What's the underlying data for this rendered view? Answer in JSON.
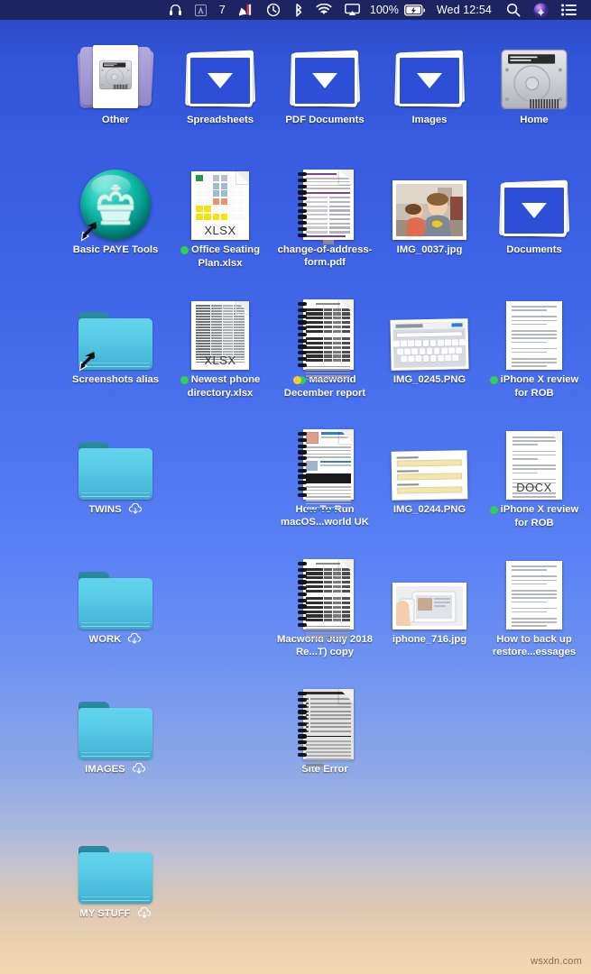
{
  "menubar": {
    "background_color": "#1e2461",
    "items": [
      {
        "name": "headphones-icon",
        "type": "icon",
        "label": "headphones"
      },
      {
        "name": "adobe-icon",
        "type": "icon",
        "label": "A"
      },
      {
        "name": "seven-indicator",
        "type": "text",
        "label": "7"
      },
      {
        "name": "textexpander-icon",
        "type": "icon",
        "label": "textexpander"
      },
      {
        "name": "time-machine-icon",
        "type": "icon",
        "label": "time-machine"
      },
      {
        "name": "bluetooth-icon",
        "type": "icon",
        "label": "bluetooth"
      },
      {
        "name": "wifi-icon",
        "type": "icon",
        "label": "wifi"
      },
      {
        "name": "airplay-icon",
        "type": "icon",
        "label": "airplay"
      }
    ],
    "battery_percent": "100%",
    "clock": "Wed 12:54",
    "search_icon": "search-icon",
    "siri_icon": "siri-icon",
    "control_center_icon": "notification-center-icon"
  },
  "desktop": {
    "watermark": "wsxdn.com",
    "columns": 5,
    "icons": [
      {
        "id": "other",
        "label": "Other",
        "type": "other-stack",
        "row": 0,
        "col": 0,
        "tags": [],
        "cloud": false,
        "alias": false
      },
      {
        "id": "spreadsheets",
        "label": "Spreadsheets",
        "type": "stack",
        "row": 0,
        "col": 1,
        "tags": [],
        "cloud": false,
        "alias": false
      },
      {
        "id": "pdf-documents",
        "label": "PDF Documents",
        "type": "stack",
        "row": 0,
        "col": 2,
        "tags": [],
        "cloud": false,
        "alias": false
      },
      {
        "id": "images-stack",
        "label": "Images",
        "type": "stack",
        "row": 0,
        "col": 3,
        "tags": [],
        "cloud": false,
        "alias": false
      },
      {
        "id": "home",
        "label": "Home",
        "type": "harddisk",
        "row": 0,
        "col": 4,
        "tags": [],
        "cloud": false,
        "alias": false
      },
      {
        "id": "basic-paye-tools",
        "label": "Basic PAYE Tools",
        "type": "app-orb",
        "row": 1,
        "col": 0,
        "tags": [],
        "cloud": false,
        "alias": true
      },
      {
        "id": "office-seating-plan",
        "label": "Office Seating Plan.xlsx",
        "type": "xlsx",
        "row": 1,
        "col": 1,
        "tags": [
          "green"
        ],
        "cloud": false,
        "alias": false
      },
      {
        "id": "change-of-address-form",
        "label": "change-of-address-form.pdf",
        "type": "spiral-form",
        "row": 1,
        "col": 2,
        "tags": [],
        "cloud": false,
        "alias": false
      },
      {
        "id": "img-0037",
        "label": "IMG_0037.jpg",
        "type": "photo-kids",
        "row": 1,
        "col": 3,
        "tags": [],
        "cloud": false,
        "alias": false
      },
      {
        "id": "documents",
        "label": "Documents",
        "type": "stack",
        "row": 1,
        "col": 4,
        "tags": [],
        "cloud": false,
        "alias": false
      },
      {
        "id": "screenshots-alias",
        "label": "Screenshots alias",
        "type": "folder",
        "row": 2,
        "col": 0,
        "tags": [],
        "cloud": false,
        "alias": true
      },
      {
        "id": "newest-phone-directory",
        "label": "Newest phone directory.xlsx",
        "type": "xlsx-list",
        "row": 2,
        "col": 1,
        "tags": [
          "green"
        ],
        "cloud": false,
        "alias": false
      },
      {
        "id": "macworld-december-report",
        "label": "Macworld December report",
        "type": "spiral-table",
        "row": 2,
        "col": 2,
        "tags": [
          "yellow",
          "green"
        ],
        "cloud": false,
        "alias": false
      },
      {
        "id": "img-0245",
        "label": "IMG_0245.PNG",
        "type": "photo-keyboard",
        "row": 2,
        "col": 3,
        "tags": [],
        "cloud": false,
        "alias": false
      },
      {
        "id": "iphone-x-review-rob-1",
        "label": "iPhone X review for ROB",
        "type": "text-doc",
        "row": 2,
        "col": 4,
        "tags": [
          "green"
        ],
        "cloud": false,
        "alias": false
      },
      {
        "id": "twins",
        "label": "TWINS",
        "type": "folder",
        "row": 3,
        "col": 0,
        "tags": [],
        "cloud": true,
        "alias": false
      },
      {
        "id": "how-to-run-macos",
        "label": "How To Run macOS...world UK",
        "type": "spiral-web",
        "row": 3,
        "col": 2,
        "tags": [],
        "cloud": false,
        "alias": false
      },
      {
        "id": "img-0244",
        "label": "IMG_0244.PNG",
        "type": "photo-form",
        "row": 3,
        "col": 3,
        "tags": [],
        "cloud": false,
        "alias": false
      },
      {
        "id": "iphone-x-review-rob-2",
        "label": "iPhone X review for ROB",
        "type": "docx",
        "row": 3,
        "col": 4,
        "tags": [
          "green"
        ],
        "cloud": false,
        "alias": false
      },
      {
        "id": "work",
        "label": "WORK",
        "type": "folder",
        "row": 4,
        "col": 0,
        "tags": [],
        "cloud": true,
        "alias": false
      },
      {
        "id": "macworld-july-2018",
        "label": "Macworld July 2018 Re...T) copy",
        "type": "spiral-table",
        "row": 4,
        "col": 2,
        "tags": [],
        "cloud": false,
        "alias": false
      },
      {
        "id": "iphone-716",
        "label": "iphone_716.jpg",
        "type": "photo-iphone",
        "row": 4,
        "col": 3,
        "tags": [],
        "cloud": false,
        "alias": false
      },
      {
        "id": "how-to-back-up",
        "label": "How to back up restore...essages",
        "type": "text-doc",
        "row": 4,
        "col": 4,
        "tags": [],
        "cloud": false,
        "alias": false
      },
      {
        "id": "images-folder",
        "label": "IMAGES",
        "type": "folder",
        "row": 5,
        "col": 0,
        "tags": [],
        "cloud": true,
        "alias": false
      },
      {
        "id": "site-error",
        "label": "Site Error",
        "type": "spiral-gray",
        "row": 5,
        "col": 2,
        "tags": [],
        "cloud": false,
        "alias": false
      },
      {
        "id": "my-stuff",
        "label": "MY STUFF",
        "type": "folder",
        "row": 6,
        "col": 0,
        "tags": [],
        "cloud": true,
        "alias": false
      }
    ]
  },
  "colors": {
    "menubar_bg": "#1e2461",
    "desktop_top": "#2a47bf",
    "desktop_bottom": "#f2d9b0",
    "folder_cyan": "#57cbe6",
    "stack_blue": "#2d4fd7",
    "tag_green": "#2fd24a",
    "tag_yellow": "#ffcb2e",
    "label_text": "#ffffff"
  }
}
